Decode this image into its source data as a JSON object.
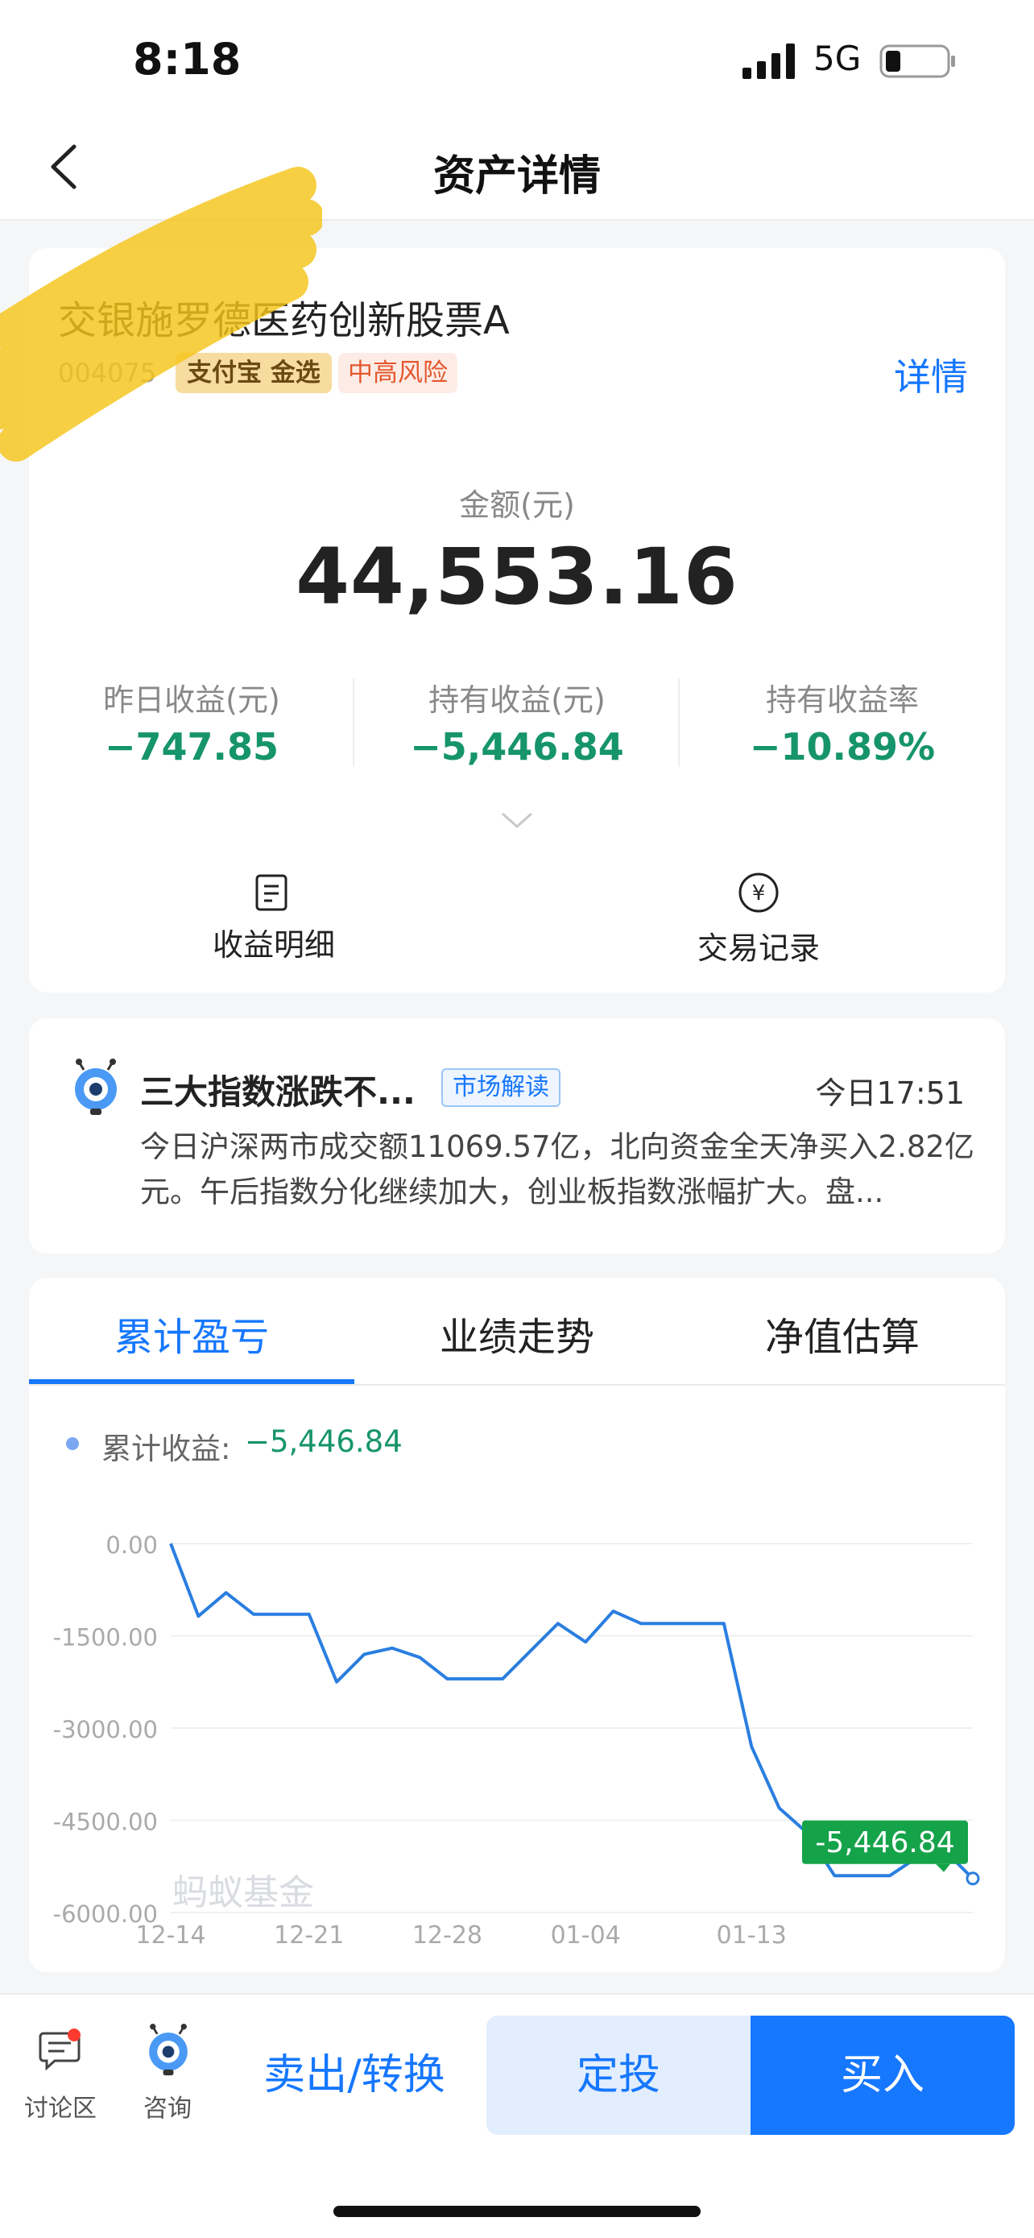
{
  "status_bar": {
    "time": "8:18",
    "network": "5G"
  },
  "nav": {
    "title": "资产详情"
  },
  "fund": {
    "name": "交银施罗德医药创新股票A",
    "code": "004075",
    "badge_platform": "支付宝 金选",
    "badge_risk": "中高风险",
    "detail_link": "详情"
  },
  "summary": {
    "amount_label": "金额(元)",
    "amount": "44,553.16",
    "stats": [
      {
        "label": "昨日收益(元)",
        "value": "−747.85"
      },
      {
        "label": "持有收益(元)",
        "value": "−5,446.84"
      },
      {
        "label": "持有收益率",
        "value": "−10.89%"
      }
    ],
    "actions": [
      {
        "label": "收益明细",
        "icon": "document-icon"
      },
      {
        "label": "交易记录",
        "icon": "yen-circle-icon"
      }
    ]
  },
  "news": {
    "title": "三大指数涨跌不...",
    "tag": "市场解读",
    "time": "今日17:51",
    "body": "今日沪深两市成交额11069.57亿，北向资金全天净买入2.82亿元。午后指数分化继续加大，创业板指数涨幅扩大。盘..."
  },
  "tabs": [
    {
      "label": "累计盈亏",
      "active": true
    },
    {
      "label": "业绩走势",
      "active": false
    },
    {
      "label": "净值估算",
      "active": false
    }
  ],
  "legend": {
    "label": "累计收益:",
    "value": "−5,446.84"
  },
  "chart_data": {
    "type": "line",
    "watermark": "蚂蚁基金",
    "y_ticks": [
      "0.00",
      "-1500.00",
      "-3000.00",
      "-4500.00",
      "-6000.00"
    ],
    "ylim": [
      -6000,
      0
    ],
    "x_ticks": [
      {
        "label": "12-14",
        "index": 0
      },
      {
        "label": "12-21",
        "index": 5
      },
      {
        "label": "12-28",
        "index": 10
      },
      {
        "label": "01-04",
        "index": 15
      },
      {
        "label": "01-13",
        "index": 21
      }
    ],
    "series": [
      {
        "values": [
          0,
          -1180,
          -800,
          -1150,
          -1150,
          -1150,
          -2250,
          -1800,
          -1700,
          -1850,
          -2200,
          -2200,
          -2200,
          -1750,
          -1300,
          -1600,
          -1100,
          -1300,
          -1300,
          -1300,
          -1300,
          -3300,
          -4300,
          -4700,
          -5400,
          -5400,
          -5400,
          -5100,
          -5000,
          -5446.84
        ],
        "end_label": "-5,446.84",
        "color": "#2a7ee0"
      }
    ],
    "grid": true
  },
  "bottom_bar": {
    "discuss_label": "讨论区",
    "consult_label": "咨询",
    "sell_label": "卖出/转换",
    "dca_label": "定投",
    "buy_label": "买入"
  },
  "colors": {
    "accent": "#1677ff",
    "loss": "#16946b",
    "tag_end": "#15a34a"
  }
}
